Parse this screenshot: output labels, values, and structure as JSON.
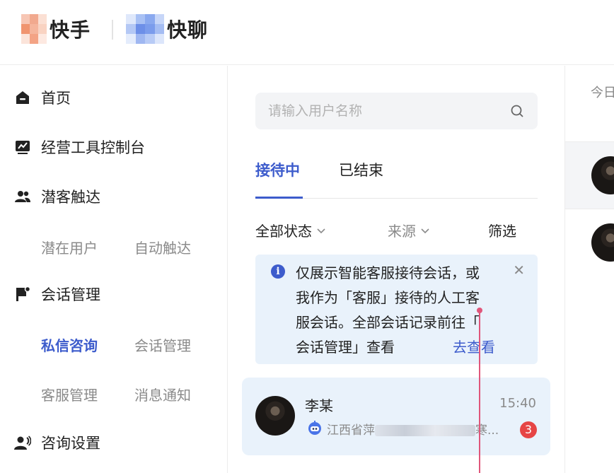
{
  "header": {
    "brand1": "快手",
    "brand2": "快聊"
  },
  "sidebar": {
    "items": [
      {
        "label": "首页",
        "icon": "home-icon"
      },
      {
        "label": "经营工具控制台",
        "icon": "dashboard-icon"
      },
      {
        "label": "潜客触达",
        "icon": "users-icon"
      },
      {
        "label": "会话管理",
        "icon": "chat-flag-icon"
      },
      {
        "label": "咨询设置",
        "icon": "headset-user-icon"
      }
    ],
    "sub_outreach": [
      "潜在用户",
      "自动触达"
    ],
    "sub_conversation": [
      "私信咨询",
      "会话管理",
      "客服管理",
      "消息通知"
    ],
    "active_sub": "私信咨询"
  },
  "search": {
    "placeholder": "请输入用户名称"
  },
  "tabs": [
    "接待中",
    "已结束"
  ],
  "filters": {
    "status": "全部状态",
    "source": "来源",
    "filter": "筛选"
  },
  "notice": {
    "line1": "仅展示智能客服接待会话，或",
    "line2": "我作为「客服」接待的人工客",
    "line3": "服会话。全部会话记录前往「",
    "line4": "会话管理」查看",
    "link": "去查看"
  },
  "conversation": {
    "name": "李某",
    "time": "15:40",
    "preview_prefix": "江西省萍",
    "preview_suffix": "寒...",
    "unread": "3"
  },
  "right_panel": {
    "date_label": "今日"
  },
  "colors": {
    "accent": "#3d5ccc",
    "notice_bg": "#e9f2fb",
    "badge": "#e64545"
  }
}
